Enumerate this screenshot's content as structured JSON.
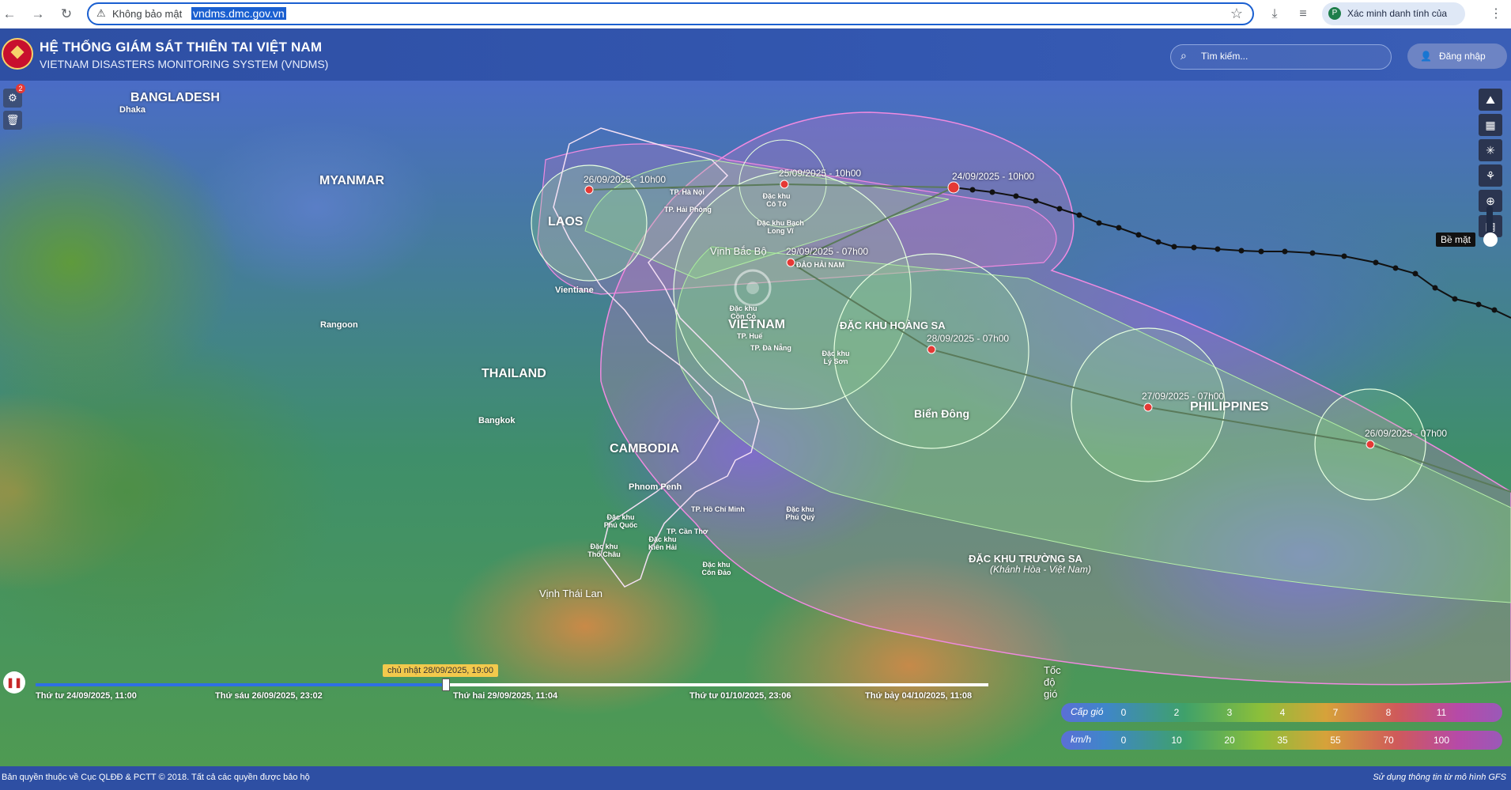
{
  "browser": {
    "security_text": "Không bảo mật",
    "url": "vndms.dmc.gov.vn",
    "identity_text": "Xác minh danh tính của bạn"
  },
  "header": {
    "title_vn": "HỆ THỐNG GIÁM SÁT THIÊN TAI VIỆT NAM",
    "title_en": "VIETNAM DISASTERS MONITORING SYSTEM (VNDMS)",
    "search_placeholder": "Tìm kiếm...",
    "login_label": "Đăng nhập"
  },
  "map": {
    "countries": [
      "BANGLADESH",
      "MYANMAR",
      "LAOS",
      "THAILAND",
      "CAMBODIA",
      "VIETNAM",
      "PHILIPPINES"
    ],
    "cities": [
      "Dhaka",
      "Rangoon",
      "Vientiane",
      "Bangkok",
      "Phnom Penh",
      "TP. Hồ Chí Minh",
      "TP. Cần Thơ",
      "TP. Huế",
      "TP. Đà Nẵng",
      "TP. Hà Nội",
      "TP. Hải Phòng"
    ],
    "places": {
      "vinh_bac_bo": "Vịnh Bắc Bộ",
      "dao_hai_nam": "ĐẢO HẢI NAM",
      "hoang_sa": "ĐẶC KHU HOÀNG SA",
      "bien_dong": "Biển Đông",
      "truong_sa": "ĐẶC KHU TRƯỜNG SA",
      "truong_sa_sub": "(Khánh Hòa - Việt Nam)",
      "vinh_thai_lan": "Vịnh Thái Lan",
      "bach_long_vi": "Đặc khu Bạch Long Vĩ",
      "con_co": "Đặc khu Cồn Cỏ",
      "ly_son": "Đặc khu Lý Sơn",
      "phu_quoc": "Đặc khu Phú Quốc",
      "kien_hai": "Đặc khu Kiên Hải",
      "tho_chau": "Đặc khu Thổ Châu",
      "con_dao": "Đặc khu Côn Đảo",
      "phu_quy": "Đặc khu Phú Quý",
      "co_to": "Đặc khu Cô Tô"
    },
    "forecast_points": [
      {
        "label": "26/09/2025 - 10h00"
      },
      {
        "label": "25/09/2025 - 10h00"
      },
      {
        "label": "24/09/2025 - 10h00"
      },
      {
        "label": "29/09/2025 - 07h00"
      },
      {
        "label": "28/09/2025 - 07h00"
      },
      {
        "label": "27/09/2025 - 07h00"
      },
      {
        "label": "26/09/2025 - 07h00"
      }
    ],
    "notifications_count": "2",
    "layer_label": "Bề mặt",
    "wind_title": "Tốc độ gió"
  },
  "timeline": {
    "current": "chủ nhật 28/09/2025, 19:00",
    "progress": 0.43,
    "ticks": [
      "Thứ tư 24/09/2025, 11:00",
      "Thứ sáu 26/09/2025, 23:02",
      "Thứ hai 29/09/2025, 11:04",
      "Thứ tư 01/10/2025, 23:06",
      "Thứ bảy 04/10/2025, 11:08"
    ]
  },
  "legend": {
    "cap_gio_label": "Cấp gió",
    "cap_gio_values": [
      "0",
      "2",
      "3",
      "4",
      "7",
      "8",
      "11"
    ],
    "kmh_label": "km/h",
    "kmh_values": [
      "0",
      "10",
      "20",
      "35",
      "55",
      "70",
      "100"
    ]
  },
  "footer": {
    "copyright": "Bản quyền thuộc về Cục QLĐĐ & PCTT © 2018. Tất cả các quyền được bảo hộ",
    "model_note": "Sử dụng thông tin từ mô hình GFS"
  },
  "colors": {
    "header_bg": "#2e4fa3",
    "cone_outer": "#ff7ee8",
    "cone_inner": "#9be38a",
    "storm_marker": "#e53935",
    "track_past": "#111111"
  }
}
